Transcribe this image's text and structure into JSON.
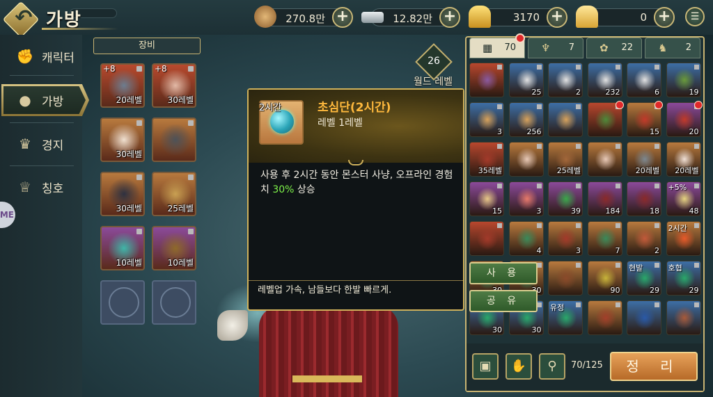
{
  "header": {
    "title": "가방",
    "currencies": [
      {
        "name": "coin",
        "value": "270.8만",
        "color": "#b8864a"
      },
      {
        "name": "silver",
        "value": "12.82만",
        "color": "#b9c3c8"
      },
      {
        "name": "gold",
        "value": "3170",
        "color": "#e6b73a"
      },
      {
        "name": "ingot",
        "value": "0",
        "color": "#f0c64a"
      }
    ]
  },
  "sidebar": {
    "items": [
      {
        "label": "캐릭터",
        "icon": "character-icon"
      },
      {
        "label": "가방",
        "icon": "bag-icon",
        "active": true
      },
      {
        "label": "경지",
        "icon": "realm-icon"
      },
      {
        "label": "칭호",
        "icon": "title-icon"
      }
    ],
    "me_tab": "ME"
  },
  "equipment": {
    "header": "장비",
    "slots": [
      {
        "level": "20레벨",
        "plus": "+8",
        "color": "#b84a2e",
        "art": "#6d7d8f"
      },
      {
        "level": "30레벨",
        "plus": "+8",
        "color": "#b84a2e",
        "art": "#e2b9a6"
      },
      {
        "level": "30레벨",
        "plus": "",
        "color": "#b87a3e",
        "art": "#f0e0d0"
      },
      {
        "level": "",
        "plus": "",
        "color": "#b87a3e",
        "art": "#4d5258"
      },
      {
        "level": "30레벨",
        "plus": "",
        "color": "#b87a3e",
        "art": "#2e3140"
      },
      {
        "level": "25레벨",
        "plus": "",
        "color": "#b87a3e",
        "art": "#c9a052"
      },
      {
        "level": "10레벨",
        "plus": "",
        "color": "#8b4a9a",
        "art": "#3fb6a8"
      },
      {
        "level": "10레벨",
        "plus": "",
        "color": "#8b4a9a",
        "art": "#8f6a2a"
      },
      {
        "level": "",
        "plus": "",
        "color": "",
        "art": ""
      },
      {
        "level": "",
        "plus": "",
        "color": "",
        "art": ""
      }
    ]
  },
  "world": {
    "level": "26",
    "label": "월드 레벨"
  },
  "tooltip": {
    "icon_label": "2시간",
    "name": "초심단(2시간)",
    "level": "레벨   1레벨",
    "desc_pre": "사용 후 2시간 동안 몬스터 사냥, 오프라인 경험치 ",
    "desc_highlight": "30%",
    "desc_post": " 상승",
    "flavor": "레벨업 가속, 남들보다 한발 빠르게.",
    "name_color": "#ffb93d",
    "highlight_color": "#7ff44a"
  },
  "actions": {
    "use": "사 용",
    "share": "공 유"
  },
  "inventory": {
    "tabs": [
      {
        "count": "70",
        "icon": "grid-icon",
        "glyph": "▦",
        "active": true
      },
      {
        "count": "7",
        "icon": "potion-tab-icon",
        "glyph": "♆"
      },
      {
        "count": "22",
        "icon": "gem-tab-icon",
        "glyph": "✿"
      },
      {
        "count": "2",
        "icon": "pet-tab-icon",
        "glyph": "♞"
      }
    ],
    "slots": [
      {
        "c": "#b8472e",
        "a": "#8a5aa0",
        "n": ""
      },
      {
        "c": "#3d6fa6",
        "a": "#e2e2e2",
        "n": "25"
      },
      {
        "c": "#3d6fa6",
        "a": "#e2e2e2",
        "n": "2"
      },
      {
        "c": "#3d6fa6",
        "a": "#e2e2e2",
        "n": "232"
      },
      {
        "c": "#3d6fa6",
        "a": "#e2e2e2",
        "n": "6"
      },
      {
        "c": "#3d6fa6",
        "a": "#6a9a3a",
        "n": "19"
      },
      {
        "c": "#3d6fa6",
        "a": "#d7a25c",
        "n": "3"
      },
      {
        "c": "#3d6fa6",
        "a": "#d7a25c",
        "n": "256"
      },
      {
        "c": "#3d6fa6",
        "a": "#d7a25c",
        "n": ""
      },
      {
        "c": "#b8472e",
        "a": "#4d8a3a",
        "n": "",
        "dot": true
      },
      {
        "c": "#b87a3e",
        "a": "#c23a2a",
        "n": "15",
        "dot": true
      },
      {
        "c": "#8b4a9a",
        "a": "#c23a2a",
        "n": "20",
        "dot": true
      },
      {
        "c": "#b8472e",
        "a": "#a33a2a",
        "n": "35레벨"
      },
      {
        "c": "#b87a3e",
        "a": "#e8c9b7",
        "n": ""
      },
      {
        "c": "#b87a3e",
        "a": "#a3673a",
        "n": "25레벨"
      },
      {
        "c": "#b87a3e",
        "a": "#e8c9b7",
        "n": ""
      },
      {
        "c": "#b87a3e",
        "a": "#7d8890",
        "n": "20레벨"
      },
      {
        "c": "#b87a3e",
        "a": "#f0e0d6",
        "n": "20레벨"
      },
      {
        "c": "#8b4a9a",
        "a": "#e8c888",
        "n": "15"
      },
      {
        "c": "#8b4a9a",
        "a": "#e87a6a",
        "n": "3"
      },
      {
        "c": "#8b4a9a",
        "a": "#3aa84a",
        "n": "39"
      },
      {
        "c": "#8b4a9a",
        "a": "#8a2a2a",
        "n": "184"
      },
      {
        "c": "#8b4a9a",
        "a": "#8a2a2a",
        "n": "18"
      },
      {
        "c": "#8b4a9a",
        "a": "#e6d480",
        "n": "48",
        "lbl": "+5%"
      },
      {
        "c": "#b8472e",
        "a": "#a33a2a",
        "n": ""
      },
      {
        "c": "#b87a3e",
        "a": "#3a8a5a",
        "n": "4"
      },
      {
        "c": "#b87a3e",
        "a": "#a33a2a",
        "n": "3"
      },
      {
        "c": "#b87a3e",
        "a": "#3a8a5a",
        "n": "7"
      },
      {
        "c": "#b87a3e",
        "a": "#c25a3a",
        "n": "2"
      },
      {
        "c": "#b87a3e",
        "a": "#e85a2a",
        "n": "",
        "lbl": "2시간"
      },
      {
        "c": "#b87a3e",
        "a": "#2a8a5a",
        "n": "30"
      },
      {
        "c": "#b87a3e",
        "a": "#2a8a5a",
        "n": "30"
      },
      {
        "c": "#b87a3e",
        "a": "#8a4a2a",
        "n": ""
      },
      {
        "c": "#b87a3e",
        "a": "#c8b43a",
        "n": "90"
      },
      {
        "c": "#3d6fa6",
        "a": "#2aa86a",
        "n": "29",
        "lbl": "현발"
      },
      {
        "c": "#3d6fa6",
        "a": "#2aa86a",
        "n": "29",
        "lbl": "호협"
      },
      {
        "c": "#3d6fa6",
        "a": "#2aa86a",
        "n": "30"
      },
      {
        "c": "#3d6fa6",
        "a": "#2aa86a",
        "n": "30"
      },
      {
        "c": "#3d6fa6",
        "a": "#2aa86a",
        "n": "",
        "lbl": "유정"
      },
      {
        "c": "#b87a3e",
        "a": "#a3402a",
        "n": ""
      },
      {
        "c": "#3d6fa6",
        "a": "#2a5aa8",
        "n": ""
      },
      {
        "c": "#3d6fa6",
        "a": "#a85a3a",
        "n": ""
      }
    ],
    "capacity": "70/125",
    "sort_label": "정 리"
  }
}
